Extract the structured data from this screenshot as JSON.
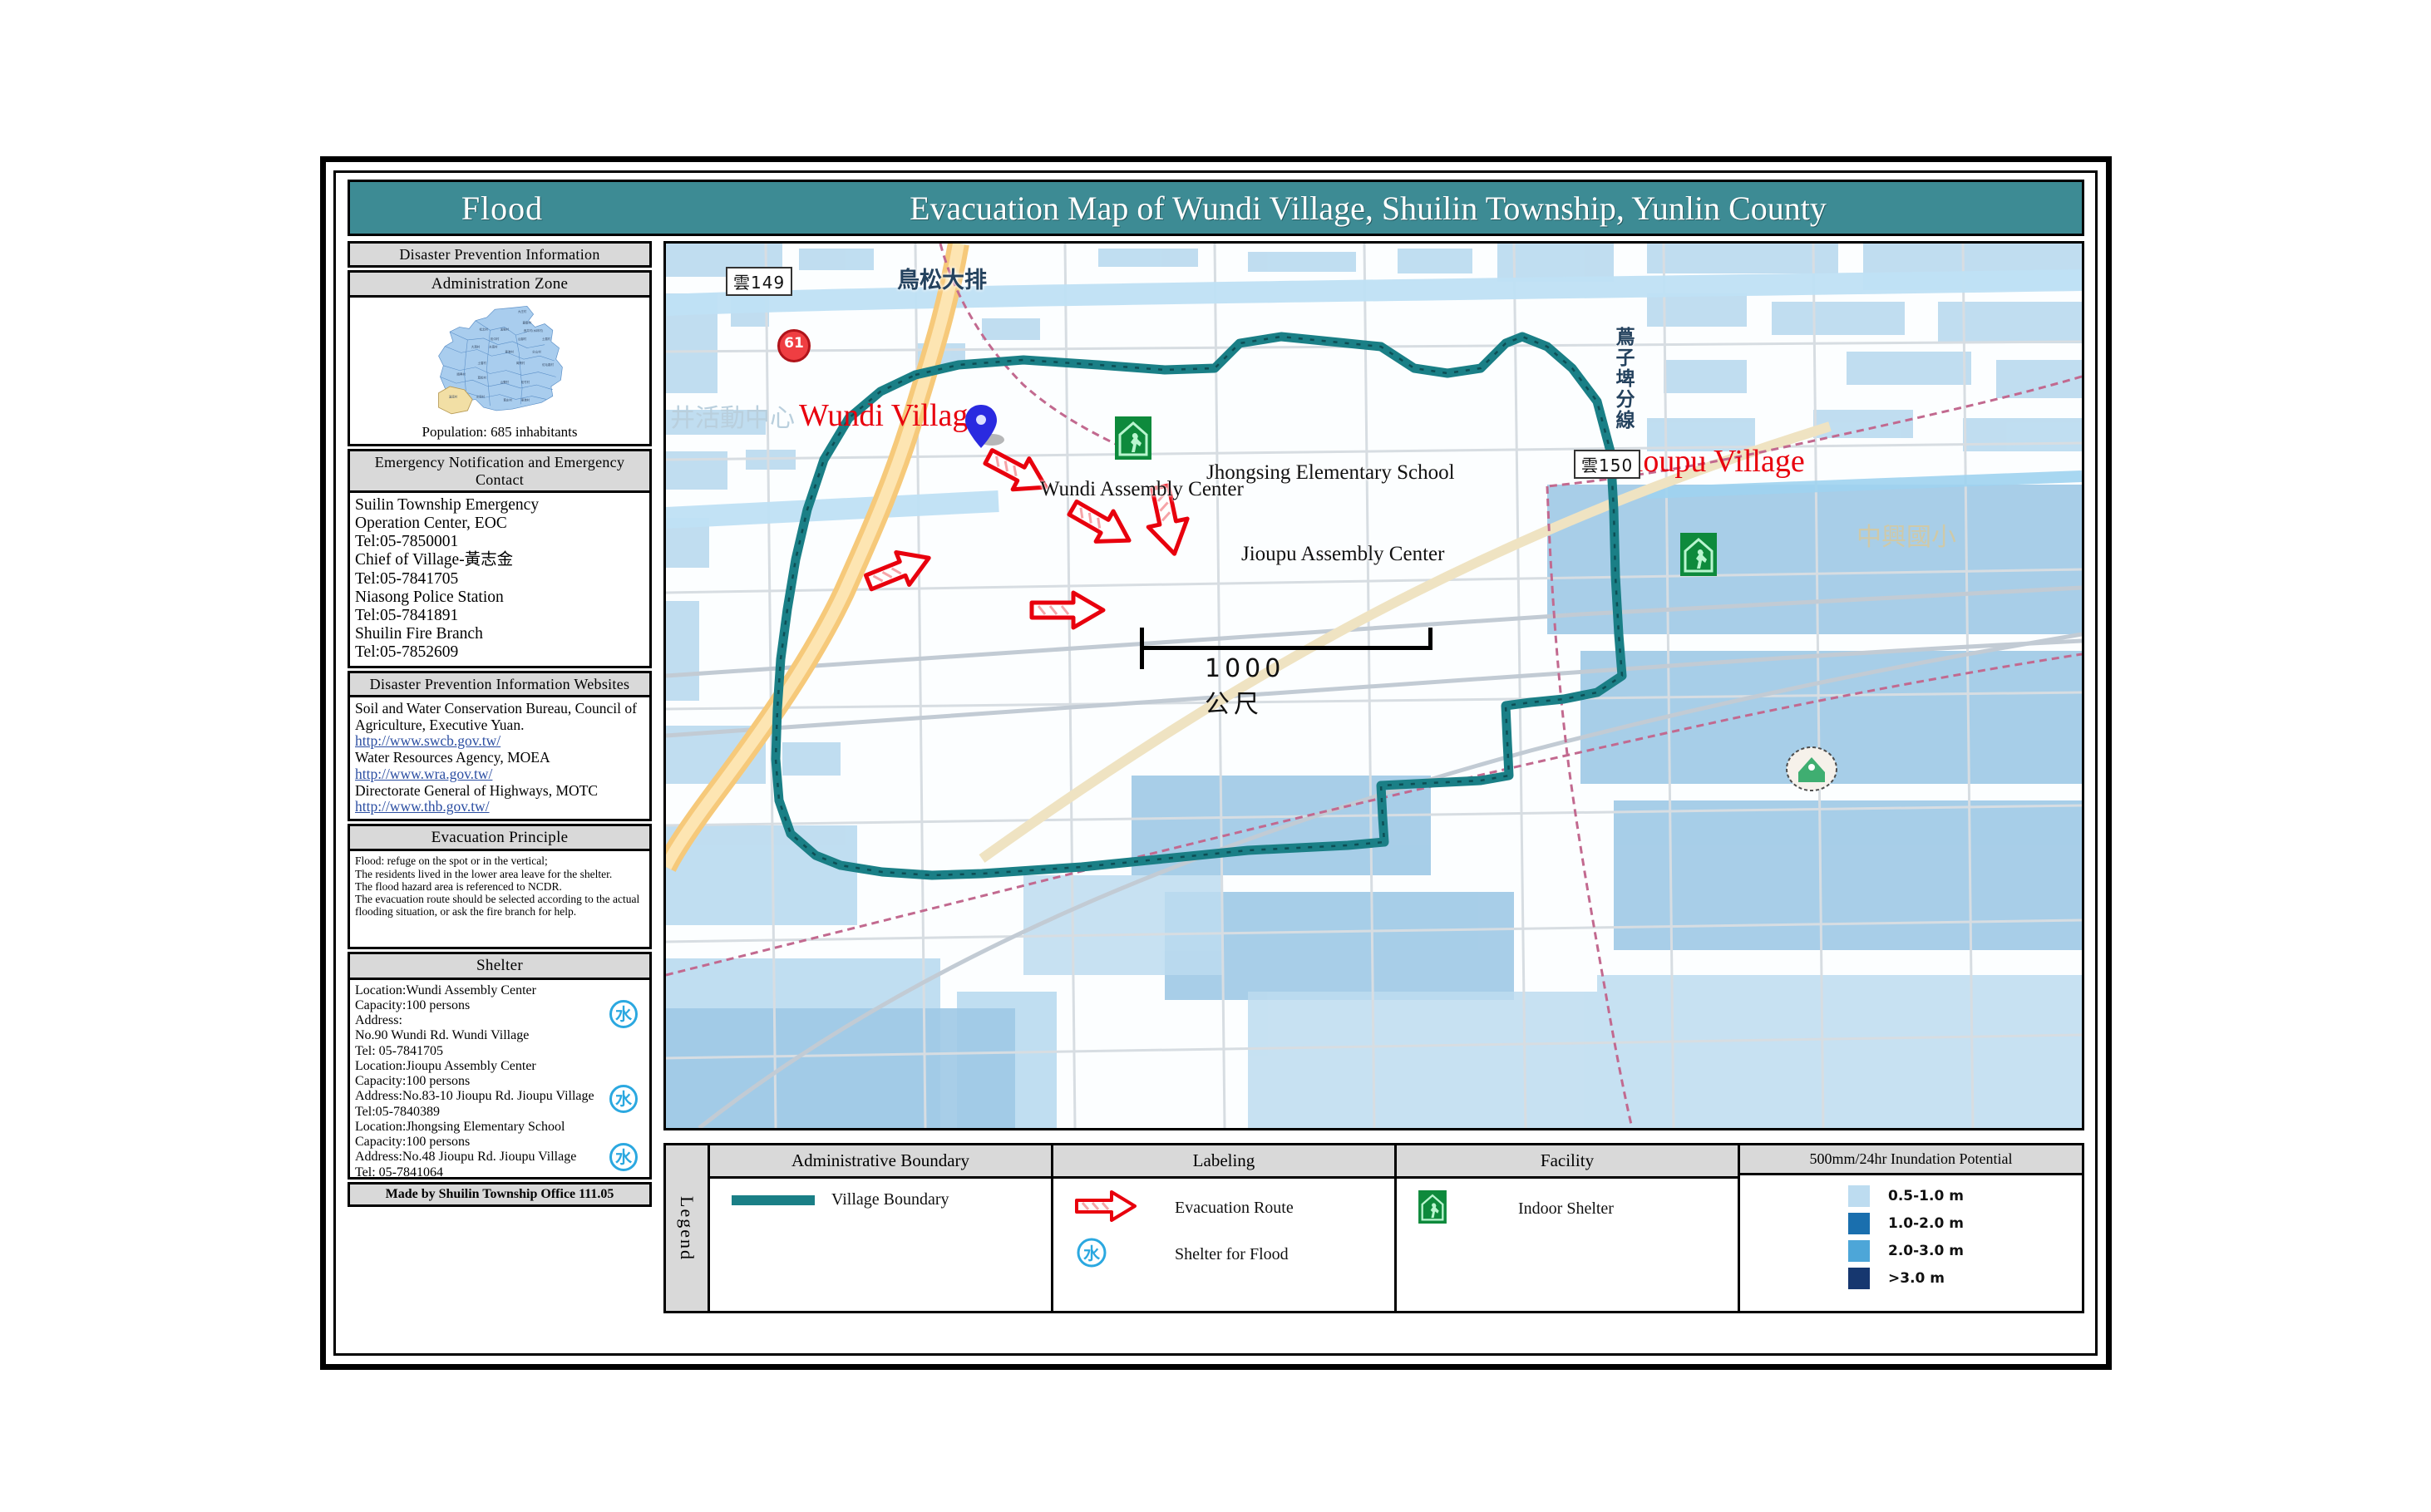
{
  "header": {
    "flood_label": "Flood",
    "title": "Evacuation Map of  Wundi Village, Shuilin Township, Yunlin County"
  },
  "sidebar": {
    "disaster_info_header": "Disaster  Prevention  Information",
    "admin_zone": {
      "header": "Administration Zone",
      "population": "Population: 685 inhabitants"
    },
    "emergency": {
      "header": "Emergency  Notification and Emergency Contact",
      "contacts": "Suilin Township Emergency\nOperation Center, EOC\nTel:05-7850001\nChief of  Village-黃志金\nTel:05-7841705\nNiasong Police Station\nTel:05-7841891\nShuilin Fire Branch\nTel:05-7852609"
    },
    "websites": {
      "header": "Disaster Prevention Information Websites",
      "items": [
        {
          "org": "Soil and Water Conservation Bureau, Council of Agriculture, Executive Yuan.",
          "url": "http://www.swcb.gov.tw/"
        },
        {
          "org": "Water Resources Agency, MOEA",
          "url": "http://www.wra.gov.tw/"
        },
        {
          "org": "Directorate General of Highways, MOTC",
          "url": "http://www.thb.gov.tw/"
        }
      ]
    },
    "principle": {
      "header": "Evacuation Principle",
      "text": "Flood: refuge on the spot or in the vertical;\nThe residents lived in the lower area leave for the shelter.\nThe flood hazard area is referenced to NCDR.\nThe evacuation route should be selected according to the actual flooding situation, or ask the fire branch for help."
    },
    "shelter": {
      "header": "Shelter",
      "text": "Location:Wundi Assembly Center\nCapacity:100 persons\nAddress:\nNo.90 Wundi Rd. Wundi Village\nTel: 05-7841705\nLocation:Jioupu Assembly Center\nCapacity:100 persons\nAddress:No.83-10 Jioupu Rd. Jioupu Village\nTel:05-7840389\nLocation:Jhongsing Elementary School\nCapacity:100 persons\nAddress:No.48 Jioupu Rd. Jioupu Village\nTel: 05-7841064"
    },
    "made_by": "Made by Shuilin Township Office 111.05"
  },
  "map": {
    "labels": {
      "wundi_village": "Wundi  Village",
      "jioupu_village": "Jioupu  Village",
      "wundi_assembly_center": "Wundi Assembly Center",
      "jioupu_assembly_center": "Jioupu Assembly Center",
      "jhongsing_elementary_school": "Jhongsing Elementary School",
      "road_yun149": "雲149",
      "road_yun150": "雲150",
      "highway_61": "61",
      "drainage_niaosong": "鳥松大排",
      "canal_label": "蔦子埤分線",
      "school_cn": "中興國小",
      "activity_center_cn": "井活動中心"
    },
    "scale": {
      "text": "1000公尺"
    }
  },
  "legend": {
    "tab_label": "Legend",
    "columns": [
      {
        "header": "Administrative Boundary",
        "items": [
          {
            "key": "boundary-line",
            "label": "Village Boundary"
          }
        ]
      },
      {
        "header": "Labeling",
        "items": [
          {
            "key": "red-arrow-icon",
            "label": "Evacuation Route"
          },
          {
            "key": "water-shelter-icon",
            "label": "Shelter for Flood"
          }
        ]
      },
      {
        "header": "Facility",
        "items": [
          {
            "key": "indoor-shelter-icon",
            "label": "Indoor Shelter"
          }
        ]
      }
    ],
    "inundation": {
      "header": "500mm/24hr  Inundation  Potential",
      "classes": [
        {
          "label": "0.5-1.0 m",
          "color": "#bddcf0"
        },
        {
          "label": "1.0-2.0 m",
          "color": "#1a6fae"
        },
        {
          "label": "2.0-3.0 m",
          "color": "#4da6d8"
        },
        {
          "label": ">3.0 m",
          "color": "#16376f"
        }
      ]
    }
  },
  "colors": {
    "title_bar": "#3d8b94",
    "village_boundary": "#1a7f86",
    "red_label": "#e8000d",
    "shelter_green": "#0e8a3c"
  }
}
